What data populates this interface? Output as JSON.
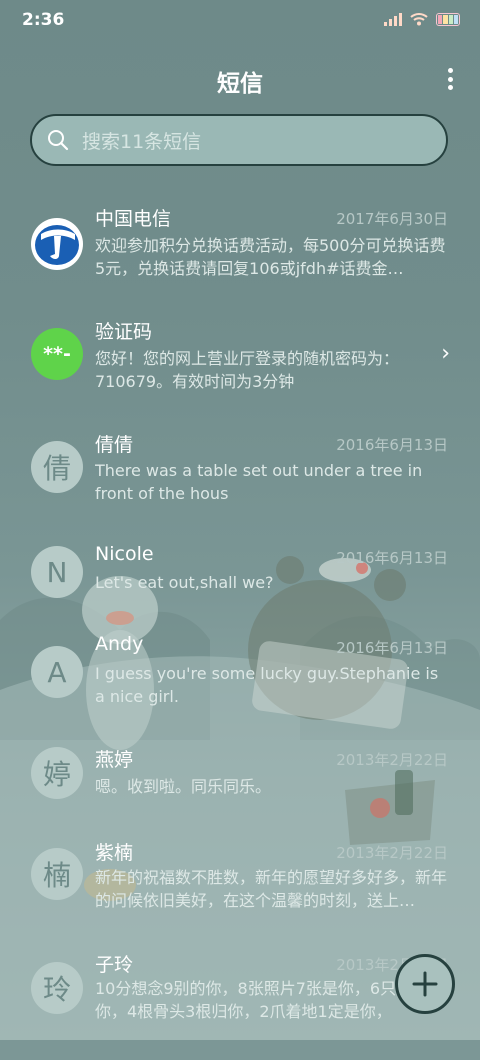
{
  "status": {
    "time": "2:36"
  },
  "header": {
    "title": "短信"
  },
  "search": {
    "placeholder": "搜索11条短信"
  },
  "avatar_icons": {
    "telecom": "china-telecom-logo",
    "code": "verification-code-icon"
  },
  "messages": [
    {
      "name": "中国电信",
      "date": "2017年6月30日",
      "preview": "欢迎参加积分兑换话费活动，每500分可兑换话费5元，兑换话费请回复106或jfdh#话费金…",
      "avatar": ""
    },
    {
      "name": "验证码",
      "date": "",
      "preview": "您好！您的网上营业厅登录的随机密码为：710679。有效时间为3分钟",
      "avatar": "**-"
    },
    {
      "name": "倩倩",
      "date": "2016年6月13日",
      "preview": "There was a table set out under a tree in front of the hous",
      "avatar": "倩"
    },
    {
      "name": "Nicole",
      "date": "2016年6月13日",
      "preview": "Let's eat out,shall we?",
      "avatar": "N"
    },
    {
      "name": "Andy",
      "date": "2016年6月13日",
      "preview": "I guess you're some lucky guy.Stephanie is a nice girl.",
      "avatar": "A"
    },
    {
      "name": "燕婷",
      "date": "2013年2月22日",
      "preview": "嗯。收到啦。同乐同乐。",
      "avatar": "婷"
    },
    {
      "name": "紫楠",
      "date": "2013年2月22日",
      "preview": "新年的祝福数不胜数，新年的愿望好多好多，新年的问候依旧美好，在这个温馨的时刻，送上…",
      "avatar": "楠"
    },
    {
      "name": "子玲",
      "date": "2013年2月22日",
      "preview": "10分想念9别的你，8张照片7张是你，6只…只像你，4根骨头3根归你，2爪着地1定是你，",
      "avatar": "玲"
    }
  ]
}
